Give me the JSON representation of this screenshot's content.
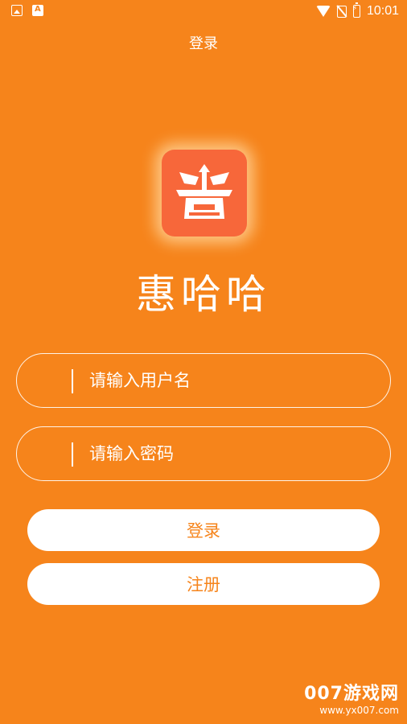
{
  "status_bar": {
    "time": "10:01",
    "icons": [
      "image-icon",
      "a-icon",
      "wifi-icon",
      "no-sim-icon",
      "battery-charging-icon"
    ]
  },
  "header": {
    "title": "登录"
  },
  "app": {
    "brand_name": "惠哈哈",
    "logo_icon": "app-logo-icon"
  },
  "form": {
    "username": {
      "value": "",
      "placeholder": "请输入用户名"
    },
    "password": {
      "value": "",
      "placeholder": "请输入密码"
    }
  },
  "buttons": {
    "login_label": "登录",
    "register_label": "注册"
  },
  "watermark": {
    "main": "007游戏网",
    "sub": "www.yx007.com"
  },
  "colors": {
    "background": "#f6841b",
    "logo_bg": "#f7673a",
    "button_bg": "#ffffff",
    "button_text": "#f6841b"
  }
}
